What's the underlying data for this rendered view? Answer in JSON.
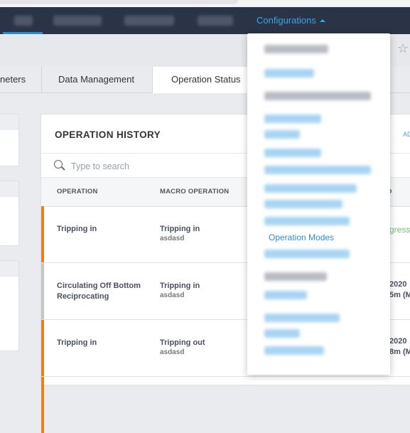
{
  "nav": {
    "configurations_label": "Configurations"
  },
  "tabs": [
    {
      "label": "neters"
    },
    {
      "label": "Data Management"
    },
    {
      "label": "Operation Status"
    }
  ],
  "panel": {
    "title": "OPERATION HISTORY",
    "add_label": "AD",
    "search_placeholder": "Type to search",
    "columns": [
      "OPERATION",
      "MACRO OPERATION",
      "ED"
    ]
  },
  "rows": [
    {
      "operation": "Tripping in",
      "macro": "Tripping in",
      "macro_sub": "asdasd",
      "end": "gress",
      "end_line2": "",
      "status_color": "#ef7d1a"
    },
    {
      "operation": "Circulating Off Bottom Reciprocating",
      "macro": "Tripping in",
      "macro_sub": "asdasd",
      "end": "2020",
      "end_line2": "5m (M",
      "status_color": "#c3c5c8"
    },
    {
      "operation": "Tripping in",
      "macro": "Tripping out",
      "macro_sub": "asdasd",
      "end": "2020",
      "end_line2": "8m (M",
      "status_color": "#ef7d1a"
    }
  ],
  "dropdown": {
    "visible_item": "Operation Modes"
  },
  "colors": {
    "navbar": "#2b3446",
    "accent": "#3aa3e8",
    "in_progress": "#6fc07a",
    "orange_status": "#ef7d1a"
  }
}
